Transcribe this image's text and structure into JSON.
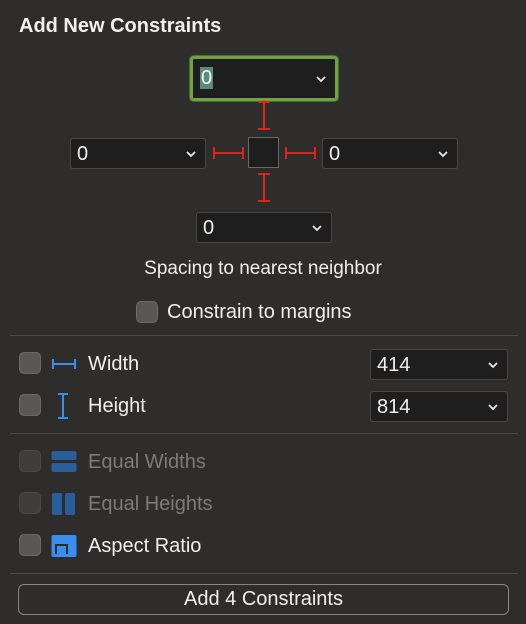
{
  "panel": {
    "title": "Add New Constraints",
    "spacing": {
      "top": "0",
      "left": "0",
      "right": "0",
      "bottom": "0",
      "caption": "Spacing to nearest neighbor"
    },
    "constrain_to_margins": {
      "label": "Constrain to margins",
      "checked": false
    },
    "width": {
      "label": "Width",
      "value": "414",
      "checked": false
    },
    "height": {
      "label": "Height",
      "value": "814",
      "checked": false
    },
    "equal_widths": {
      "label": "Equal Widths",
      "enabled": false
    },
    "equal_heights": {
      "label": "Equal Heights",
      "enabled": false
    },
    "aspect_ratio": {
      "label": "Aspect Ratio",
      "checked": false
    },
    "add_button_label": "Add 4 Constraints"
  },
  "colors": {
    "background": "#2f2d2c",
    "strut_red": "#d8261c",
    "icon_blue": "#3a8ef0",
    "focus_green": "#6fa148"
  },
  "icons": {
    "chevron": "chevron-down-icon",
    "width": "width-dimension-icon",
    "height": "height-dimension-icon",
    "equal_widths": "equal-widths-icon",
    "equal_heights": "equal-heights-icon",
    "aspect_ratio": "aspect-ratio-icon"
  }
}
